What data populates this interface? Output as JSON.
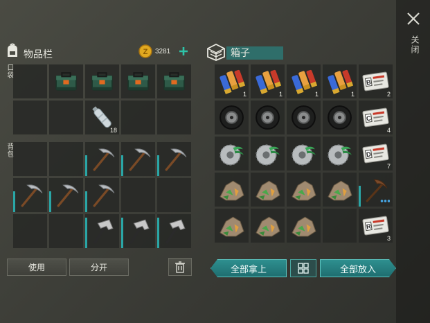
{
  "inventory": {
    "title": "物品栏",
    "currency_amount": "3281",
    "pocket_label": "口袋",
    "backpack_label": "背包",
    "use_button": "使用",
    "split_button": "分开"
  },
  "chest": {
    "title": "箱子",
    "take_all_button": "全部拿上",
    "put_all_button": "全部放入"
  },
  "close_label": "关闭",
  "pocket_slots": [
    {
      "item": "empty",
      "count": ""
    },
    {
      "item": "toolbox",
      "count": ""
    },
    {
      "item": "toolbox",
      "count": ""
    },
    {
      "item": "toolbox",
      "count": ""
    },
    {
      "item": "toolbox",
      "count": ""
    },
    {
      "item": "empty",
      "count": ""
    },
    {
      "item": "empty",
      "count": ""
    },
    {
      "item": "water-bottle",
      "count": "18"
    },
    {
      "item": "empty",
      "count": ""
    },
    {
      "item": "empty",
      "count": ""
    }
  ],
  "backpack_slots": [
    {
      "item": "empty",
      "count": ""
    },
    {
      "item": "empty",
      "count": ""
    },
    {
      "item": "pickaxe",
      "count": ""
    },
    {
      "item": "pickaxe",
      "count": ""
    },
    {
      "item": "pickaxe",
      "count": ""
    },
    {
      "item": "pickaxe",
      "count": ""
    },
    {
      "item": "pickaxe",
      "count": ""
    },
    {
      "item": "pickaxe",
      "count": ""
    },
    {
      "item": "empty",
      "count": ""
    },
    {
      "item": "empty",
      "count": ""
    },
    {
      "item": "empty",
      "count": ""
    },
    {
      "item": "empty",
      "count": ""
    },
    {
      "item": "hammer",
      "count": ""
    },
    {
      "item": "hammer",
      "count": ""
    },
    {
      "item": "hammer",
      "count": ""
    }
  ],
  "chest_slots": [
    {
      "item": "shotgun-shells",
      "count": "1"
    },
    {
      "item": "shotgun-shells",
      "count": "1"
    },
    {
      "item": "shotgun-shells",
      "count": "1"
    },
    {
      "item": "shotgun-shells",
      "count": "1"
    },
    {
      "item": "keycard-b",
      "count": "2",
      "card_letter": "B"
    },
    {
      "item": "tire",
      "count": ""
    },
    {
      "item": "tire",
      "count": ""
    },
    {
      "item": "tire",
      "count": ""
    },
    {
      "item": "tire",
      "count": ""
    },
    {
      "item": "keycard-c",
      "count": "4",
      "card_letter": "C"
    },
    {
      "item": "saw-blade",
      "count": ""
    },
    {
      "item": "saw-blade",
      "count": ""
    },
    {
      "item": "saw-blade",
      "count": ""
    },
    {
      "item": "saw-blade",
      "count": ""
    },
    {
      "item": "keycard-d",
      "count": "7",
      "card_letter": "D"
    },
    {
      "item": "ore",
      "count": ""
    },
    {
      "item": "ore",
      "count": ""
    },
    {
      "item": "ore",
      "count": ""
    },
    {
      "item": "ore",
      "count": ""
    },
    {
      "item": "pickaxe-rusty",
      "count": ""
    },
    {
      "item": "ore",
      "count": ""
    },
    {
      "item": "ore",
      "count": ""
    },
    {
      "item": "ore",
      "count": ""
    },
    {
      "item": "empty",
      "count": ""
    },
    {
      "item": "keycard-r",
      "count": "3",
      "card_letter": "R"
    }
  ],
  "colors": {
    "accent_teal": "#2e8f8f",
    "coin_gold": "#e0a820",
    "plus_teal": "#2ec4a8"
  }
}
